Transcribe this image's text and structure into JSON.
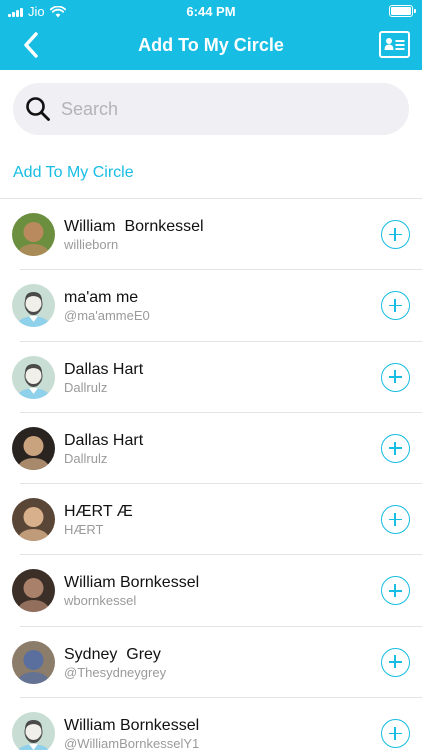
{
  "status": {
    "carrier": "Jio",
    "time": "6:44 PM"
  },
  "header": {
    "title": "Add To My Circle"
  },
  "search": {
    "placeholder": "Search"
  },
  "section": {
    "title": "Add To My Circle"
  },
  "colors": {
    "accent": "#17bde3",
    "divider": "#e3e3e3",
    "search_bg": "#efeff4"
  },
  "icons": {
    "back": "chevron-left-icon",
    "card": "contact-card-icon",
    "search": "search-icon",
    "add": "plus-circle-icon"
  },
  "contacts": [
    {
      "name": "William  Bornkessel",
      "handle": "willieborn",
      "avatar": "photo",
      "avatar_colors": [
        "#6b8f3e",
        "#b98a5e"
      ]
    },
    {
      "name": "ma'am me",
      "handle": "@ma'ammeE0",
      "avatar": "default"
    },
    {
      "name": "Dallas Hart",
      "handle": "Dallrulz",
      "avatar": "default"
    },
    {
      "name": "Dallas Hart",
      "handle": "Dallrulz",
      "avatar": "photo",
      "avatar_colors": [
        "#2a2420",
        "#c9a27e"
      ]
    },
    {
      "name": "HÆRT Æ",
      "handle": "HÆRT",
      "avatar": "photo",
      "avatar_colors": [
        "#5a4636",
        "#d8b08c"
      ]
    },
    {
      "name": "William Bornkessel",
      "handle": "wbornkessel",
      "avatar": "photo",
      "avatar_colors": [
        "#3b2f28",
        "#a9806a"
      ]
    },
    {
      "name": "Sydney  Grey",
      "handle": "@Thesydneygrey",
      "avatar": "photo",
      "avatar_colors": [
        "#8c7c6a",
        "#5a6f9e"
      ]
    },
    {
      "name": "William Bornkessel",
      "handle": "@WilliamBornkesselY1",
      "avatar": "default"
    }
  ]
}
